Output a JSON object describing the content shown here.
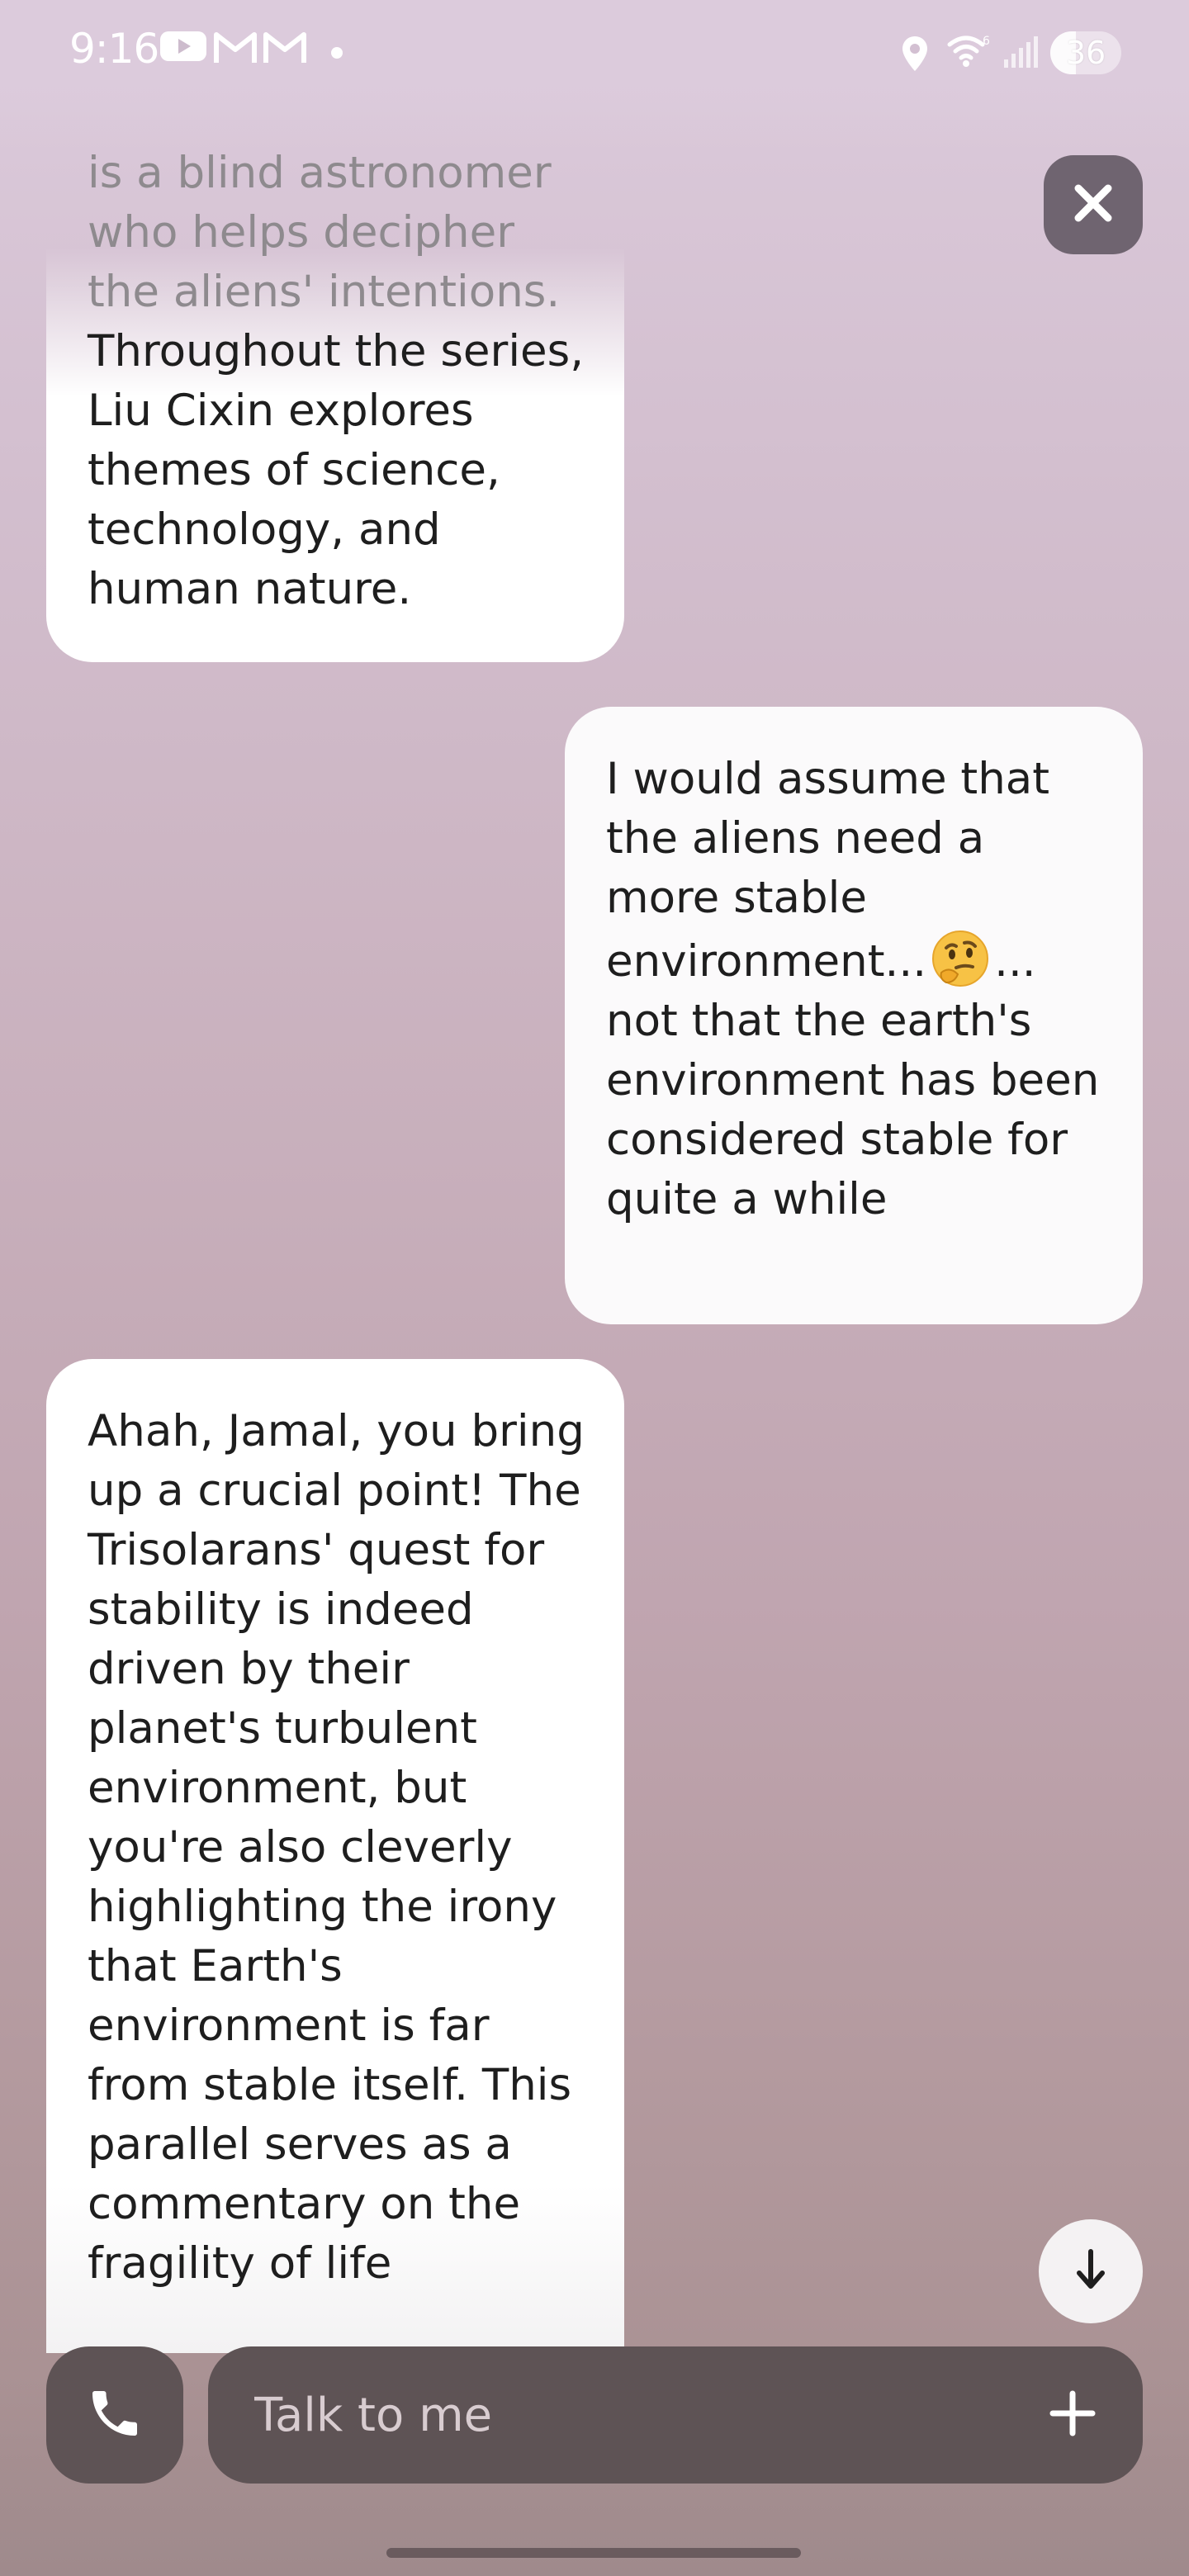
{
  "status_bar": {
    "time": "9:16",
    "battery_level": "36",
    "battery_fraction": 0.36,
    "icons": [
      "youtube-icon",
      "gmail-icon",
      "gmail-icon",
      "notification-dot-icon",
      "location-icon",
      "wifi-icon",
      "signal-icon",
      "battery-icon"
    ]
  },
  "header": {
    "close_icon": "close-icon"
  },
  "messages": [
    {
      "role": "assistant",
      "partial": true,
      "faded_text": "is a blind astronomer who helps decipher the aliens' intentions.",
      "text": "Throughout the series, Liu Cixin explores themes of science, technology, and human nature."
    },
    {
      "role": "user",
      "text_before_emoji": "I would assume that the aliens need a more stable environment...",
      "emoji": "thinking-face-emoji",
      "text_after_emoji": "... not that the earth's environment has been considered stable for quite a while"
    },
    {
      "role": "assistant",
      "partial": true,
      "text": "Ahah, Jamal, you bring up a crucial point! The Trisolarans' quest for stability is indeed driven by their planet's turbulent environment, but you're also cleverly highlighting the irony that Earth's environment is far from stable itself. This parallel serves as a commentary on the fragility of life"
    }
  ],
  "scroll_down": {
    "icon": "arrow-down-icon"
  },
  "input_bar": {
    "call_icon": "phone-icon",
    "placeholder": "Talk to me",
    "value": "",
    "add_icon": "plus-icon"
  },
  "colors": {
    "background_top": "#dccbdc",
    "background_bottom": "#9f8a8c",
    "bubble": "#ffffff",
    "input_bar": "#5e5355",
    "close_button": "#6f6470"
  }
}
